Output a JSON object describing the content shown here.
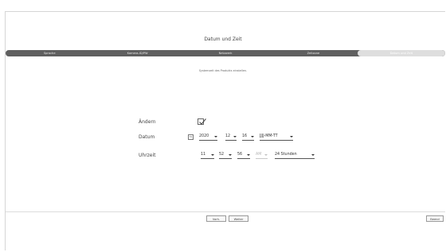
{
  "title": "Datum und Zeit",
  "tabs": [
    {
      "label": "Sprache",
      "active": false
    },
    {
      "label": "Kamera-ID/PW",
      "active": false
    },
    {
      "label": "Netzwerk",
      "active": false
    },
    {
      "label": "Zeitzone",
      "active": false
    },
    {
      "label": "Datum und Zeit",
      "active": true
    }
  ],
  "subtitle": "Systemzeit des Produkts einstellen.",
  "form": {
    "change_label": "Ändern",
    "change_checked": true,
    "date_label": "Datum",
    "date_calendar_icon": "calendar-icon",
    "year": "2020",
    "month": "12",
    "day": "16",
    "date_format": "JJJJ-MM-TT",
    "time_label": "Uhrzeit",
    "hour": "11",
    "minute": "52",
    "second": "56",
    "ampm": "AM",
    "time_format": "24 Stunden"
  },
  "footer": {
    "prev_label": "Vorh.",
    "next_label": "Weiter",
    "finish_label": "Beend"
  }
}
